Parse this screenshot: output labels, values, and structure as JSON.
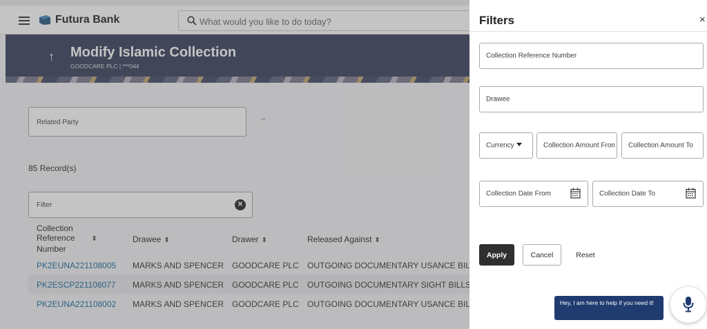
{
  "topbar": {
    "brand": "Futura Bank",
    "search_placeholder": "What would you like to do today?"
  },
  "banner": {
    "title": "Modify Islamic Collection",
    "subtitle": "GOODCARE PLC | ***044"
  },
  "main": {
    "related_party_label": "Related Party",
    "records_text": "85 Record(s)",
    "filter_placeholder": "Filter"
  },
  "table": {
    "headers": {
      "ref_line1": "Collection",
      "ref_line2": "Reference",
      "ref_line3": "Number",
      "drawee": "Drawee",
      "drawer": "Drawer",
      "released_against": "Released Against"
    },
    "rows": [
      {
        "ref": "PK2EUNA221108005",
        "drawee": "MARKS AND SPENCER",
        "drawer": "GOODCARE PLC",
        "released_against": "OUTGOING DOCUMENTARY USANCE BILLS"
      },
      {
        "ref": "PK2ESCP221108077",
        "drawee": "MARKS AND SPENCER",
        "drawer": "GOODCARE PLC",
        "released_against": "OUTGOING DOCUMENTARY SIGHT BILLS NC"
      },
      {
        "ref": "PK2EUNA221108002",
        "drawee": "MARKS AND SPENCER",
        "drawer": "GOODCARE PLC",
        "released_against": "OUTGOING DOCUMENTARY USANCE BILLS"
      }
    ]
  },
  "filters": {
    "title": "Filters",
    "close": "×",
    "collection_reference_number": "Collection Reference Number",
    "drawee": "Drawee",
    "currency": "Currency",
    "amount_from": "Collection Amount From",
    "amount_to": "Collection Amount To",
    "date_from": "Collection Date From",
    "date_to": "Collection Date To",
    "apply": "Apply",
    "cancel": "Cancel",
    "reset": "Reset"
  },
  "assistant": {
    "message": "Hey, I am here to help if you need it!"
  },
  "colors": {
    "banner": "#3e4660",
    "link": "#1f6f9e",
    "apply_button": "#2f2f2f",
    "chat_bubble": "#1f3b70",
    "mic": "#1f3b70"
  },
  "icons": [
    "hamburger-icon",
    "bank-logo-icon",
    "search-icon",
    "back-arrow-icon",
    "arrow-right-icon",
    "clear-icon",
    "sort-icon",
    "close-icon",
    "dropdown-caret-icon",
    "calendar-icon",
    "microphone-icon"
  ]
}
